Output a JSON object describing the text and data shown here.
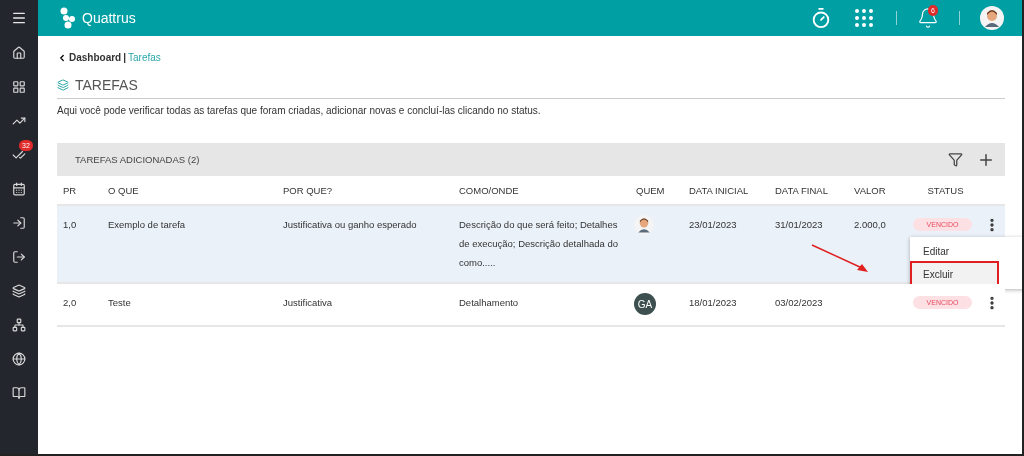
{
  "app": {
    "name": "Quattrus"
  },
  "topbar": {
    "notifications_badge": "6"
  },
  "sidebar": {
    "items": [
      {
        "kind": "home"
      },
      {
        "kind": "dashboard"
      },
      {
        "kind": "trend"
      },
      {
        "kind": "tasks",
        "badge": "32"
      },
      {
        "kind": "calendar"
      },
      {
        "kind": "enter"
      },
      {
        "kind": "exit"
      },
      {
        "kind": "layers"
      },
      {
        "kind": "hierarchy"
      },
      {
        "kind": "globe"
      },
      {
        "kind": "help"
      }
    ]
  },
  "breadcrumb": {
    "parent": "Dashboard",
    "separator": "|",
    "current": "Tarefas"
  },
  "page": {
    "title": "TAREFAS",
    "description": "Aqui você pode verificar todas as tarefas que foram criadas, adicionar novas e concluí-las clicando no status."
  },
  "panel": {
    "title": "TAREFAS ADICIONADAS (2)"
  },
  "table": {
    "columns": [
      "PR",
      "O QUE",
      "POR QUE?",
      "COMO/ONDE",
      "QUEM",
      "DATA INICIAL",
      "DATA FINAL",
      "VALOR",
      "STATUS"
    ],
    "rows": [
      {
        "selected": true,
        "menu_open": true,
        "pr": "1,0",
        "what": "Exemplo de tarefa",
        "why": "Justificativa ou ganho esperado",
        "how": "Descrição do que será feito; Detalhes de execução; Descrição detalhada do como.....",
        "who": {
          "kind": "avatar"
        },
        "start": "23/01/2023",
        "end": "31/01/2023",
        "value": "2.000,0",
        "status": "VENCIDO"
      },
      {
        "selected": false,
        "menu_open": false,
        "pr": "2,0",
        "what": "Teste",
        "why": "Justificativa",
        "how": "Detalhamento",
        "who": {
          "kind": "initials",
          "text": "GA"
        },
        "start": "18/01/2023",
        "end": "03/02/2023",
        "status": "VENCIDO"
      }
    ]
  },
  "row_menu": {
    "items": [
      {
        "label": "Editar",
        "highlighted": false
      },
      {
        "label": "Excluir",
        "highlighted": true
      }
    ]
  }
}
